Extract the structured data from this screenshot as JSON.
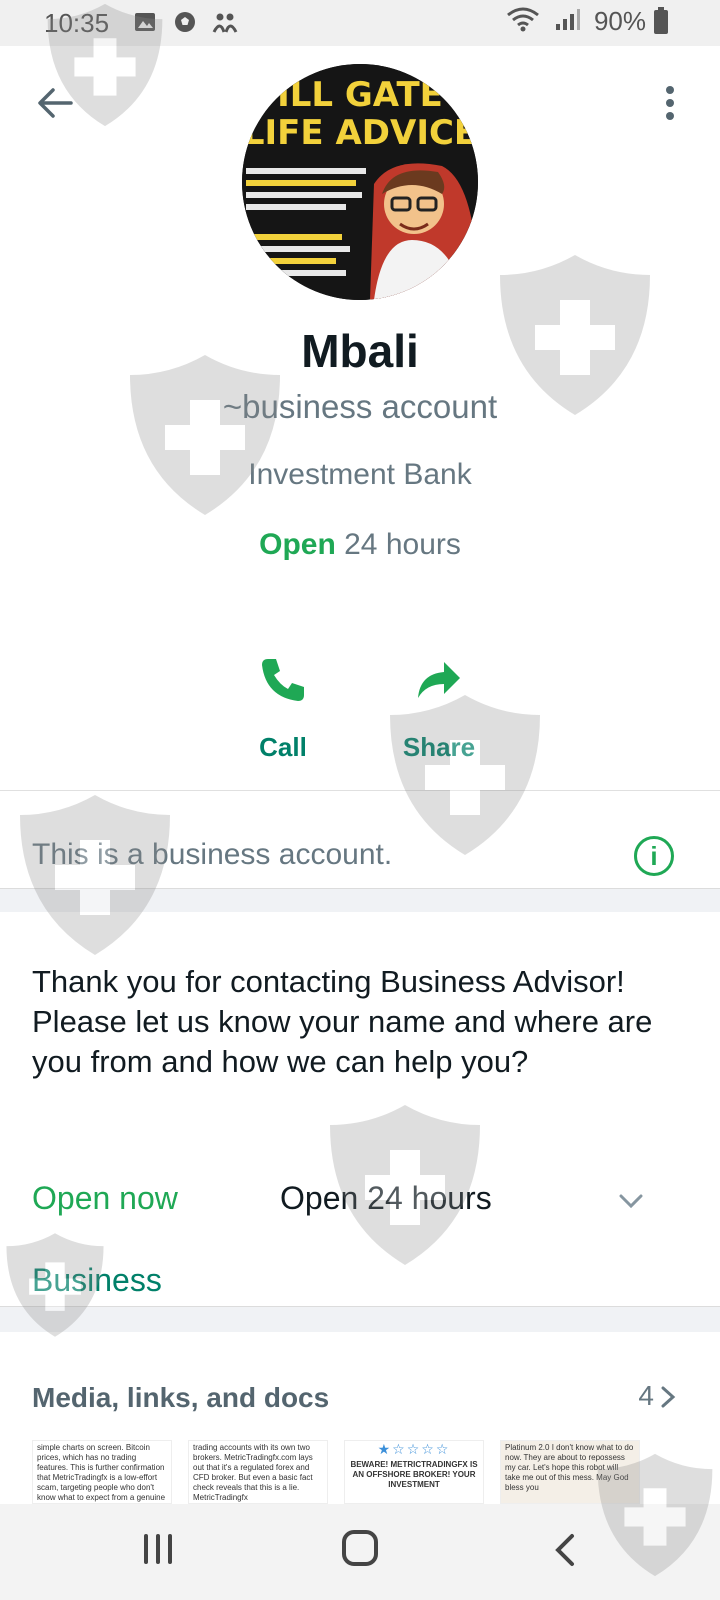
{
  "status_bar": {
    "time": "10:35",
    "battery": "90%",
    "icons": [
      "image-icon",
      "soccer-ball-icon",
      "people-icon",
      "wifi-icon",
      "signal-icon",
      "battery-icon"
    ]
  },
  "profile": {
    "avatar_text_top": "ILL GATE",
    "avatar_text_main": "LIFE ADVICE",
    "name": "Mbali",
    "subname": "~business account",
    "category": "Investment Bank",
    "hours_open_label": "Open",
    "hours_value": "24 hours"
  },
  "actions": {
    "call_label": "Call",
    "share_label": "Share"
  },
  "business_note": "This is a business account.",
  "description": "Thank you for contacting Business Advisor! Please let us know your name and where are you from and how we can help you?",
  "hours_row": {
    "status": "Open now",
    "hours": "Open 24 hours"
  },
  "business_link": "Business",
  "media": {
    "title": "Media, links, and docs",
    "count": "4",
    "thumbs": [
      "simple charts on screen. Bitcoin prices, which has no trading features. This is further confirmation that MetricTradingfx is a low-effort scam, targeting people who don't know what to expect from a genuine broker.",
      "trading accounts with its own two brokers. MetricTradingfx.com lays out that it's a regulated forex and CFD broker. But even a basic fact check reveals that this is a lie. MetricTradingfx",
      "BEWARE! METRICTRADINGFX IS AN OFFSHORE BROKER! YOUR INVESTMENT",
      "Platinum 2.0 I don't know what to do now. They are about to repossess my car. Let's hope this robot will take me out of this mess. May God bless you"
    ]
  },
  "colors": {
    "accent_green": "#1fa855",
    "teal": "#008069",
    "secondary_text": "#667781"
  }
}
